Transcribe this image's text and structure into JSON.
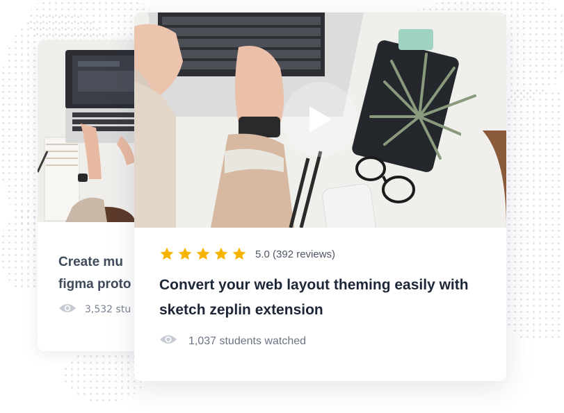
{
  "back_card": {
    "title": "Create mu\nfigma proto",
    "students": "3,532 stu"
  },
  "front_card": {
    "rating_value": 5,
    "rating_text": "5.0 (392 reviews)",
    "title": "Convert your web layout theming easily with sketch zeplin extension",
    "students": "1,037 students watched",
    "play_icon": "play-icon"
  },
  "colors": {
    "star": "#f5b400",
    "title": "#1d2636",
    "meta": "#6c7483",
    "dots": "#d3d8df"
  }
}
